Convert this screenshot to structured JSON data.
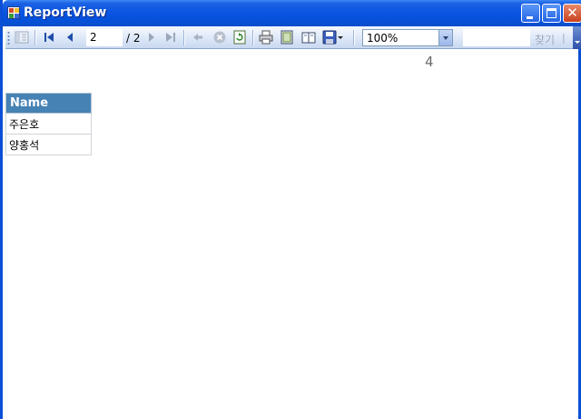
{
  "window": {
    "title": "ReportView"
  },
  "toolbar": {
    "current_page": "2",
    "total_pages": "/ 2",
    "zoom": "100%",
    "find_value": "",
    "find_label": "찾기",
    "find_separator": "|",
    "icons": [
      "document-map-icon",
      "first-page-icon",
      "previous-page-icon",
      "next-page-icon",
      "last-page-icon",
      "back-icon",
      "stop-icon",
      "refresh-icon",
      "print-icon",
      "print-layout-icon",
      "page-setup-icon",
      "export-icon"
    ]
  },
  "report": {
    "page_number": "4",
    "table": {
      "header": "Name",
      "rows": [
        "주은호",
        "양홍석"
      ]
    }
  },
  "colors": {
    "title_bar": "#0a55e2",
    "table_header": "#4682b4"
  }
}
